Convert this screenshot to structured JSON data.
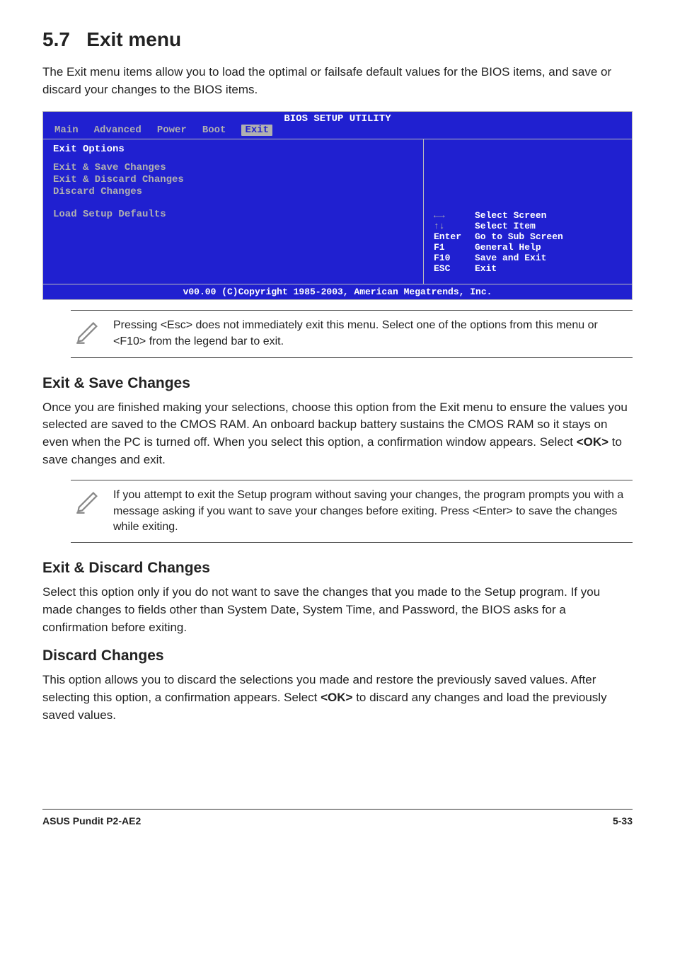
{
  "title_number": "5.7",
  "title_text": "Exit menu",
  "intro": "The Exit menu items allow you to load the optimal or failsafe default values for the BIOS items, and save or discard your changes to the BIOS items.",
  "bios": {
    "title": "BIOS SETUP UTILITY",
    "tabs": {
      "main": "Main",
      "advanced": "Advanced",
      "power": "Power",
      "boot": "Boot",
      "exit": "Exit"
    },
    "left_heading": "Exit Options",
    "items": {
      "save": "Exit & Save Changes",
      "discard_exit": "Exit & Discard Changes",
      "discard": "Discard Changes",
      "defaults": "Load Setup Defaults"
    },
    "help": {
      "arrows_lr": "←→",
      "arrows_ud": "↑↓",
      "enter": "Enter",
      "f1": "F1",
      "f10": "F10",
      "esc": "ESC",
      "select_screen": "Select Screen",
      "select_item": "Select Item",
      "sub_screen": "Go to Sub Screen",
      "general_help": "General Help",
      "save_exit": "Save and Exit",
      "exit": "Exit"
    },
    "footer": "v00.00 (C)Copyright 1985-2003, American Megatrends, Inc."
  },
  "note1": "Pressing <Esc> does not immediately exit this menu. Select one of the options from this menu or <F10> from the legend bar to exit.",
  "sub_save_heading": "Exit & Save Changes",
  "sub_save_para_a": "Once you are finished making your selections, choose this option from the Exit menu to ensure the values you selected are saved to the CMOS RAM. An onboard backup battery sustains the CMOS RAM so it stays on even when the PC is turned off. When you select this option, a confirmation window appears. Select ",
  "sub_save_para_bold": "<OK>",
  "sub_save_para_b": " to save changes and exit.",
  "note2": "If you attempt to exit the Setup program without saving your changes, the program prompts you with a message asking if you want to save your changes before exiting. Press <Enter>  to save the  changes while exiting.",
  "sub_discard_heading": "Exit & Discard Changes",
  "sub_discard_para": "Select this option only if you do not want to save the changes that you made to the Setup program. If you made changes to fields other than System Date, System Time, and Password, the BIOS asks for a confirmation before exiting.",
  "sub_discardc_heading": "Discard Changes",
  "sub_discardc_para_a": "This option allows you to discard the selections you made and restore the previously saved values. After selecting this option, a confirmation appears. Select ",
  "sub_discardc_para_bold": "<OK>",
  "sub_discardc_para_b": " to discard any changes and load the previously saved values.",
  "footer_left": "ASUS Pundit P2-AE2",
  "footer_right": "5-33"
}
